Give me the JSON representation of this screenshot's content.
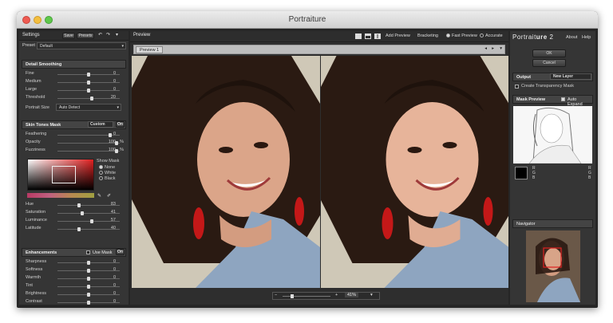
{
  "window": {
    "title": "Portraiture"
  },
  "settings": {
    "title": "Settings",
    "save": "Save",
    "presets": "Presets",
    "preset_label": "Preset",
    "preset_value": "Default"
  },
  "detail": {
    "title": "Detail Smoothing",
    "rows": [
      {
        "label": "Fine",
        "value": "0",
        "frac": 0.5
      },
      {
        "label": "Medium",
        "value": "0",
        "frac": 0.5
      },
      {
        "label": "Large",
        "value": "0",
        "frac": 0.5
      },
      {
        "label": "Threshold",
        "value": "20",
        "frac": 0.55
      }
    ],
    "portrait_size_label": "Portrait Size",
    "portrait_size_value": "Auto Detect"
  },
  "mask": {
    "title": "Skin Tones Mask",
    "mode": "Custom",
    "toggle": "On",
    "rows": [
      {
        "label": "Feathering",
        "value": "0",
        "unit": "",
        "frac": 0.85
      },
      {
        "label": "Opacity",
        "value": "100",
        "unit": "%",
        "frac": 0.95
      },
      {
        "label": "Fuzziness",
        "value": "100",
        "unit": "%",
        "frac": 0.95
      }
    ],
    "show_mask_label": "Show Mask",
    "show_mask_options": [
      "None",
      "White",
      "Black"
    ],
    "hsl": [
      {
        "label": "Hue",
        "value": "83",
        "frac": 0.35
      },
      {
        "label": "Saturation",
        "value": "41",
        "frac": 0.4
      },
      {
        "label": "Luminance",
        "value": "57",
        "frac": 0.55
      },
      {
        "label": "Latitude",
        "value": "40",
        "frac": 0.35
      }
    ]
  },
  "enh": {
    "title": "Enhancements",
    "use_mask": "Use Mask",
    "toggle": "On",
    "rows": [
      {
        "label": "Sharpness",
        "value": "0",
        "frac": 0.5
      },
      {
        "label": "Softness",
        "value": "0",
        "frac": 0.5
      },
      {
        "label": "Warmth",
        "value": "0",
        "frac": 0.5
      },
      {
        "label": "Tint",
        "value": "0",
        "frac": 0.5
      },
      {
        "label": "Brightness",
        "value": "0",
        "frac": 0.5
      },
      {
        "label": "Contrast",
        "value": "0",
        "frac": 0.5
      }
    ]
  },
  "preview": {
    "title": "Preview",
    "tab": "Preview 1",
    "add_preview": "Add Preview",
    "bracketing": "Bracketing",
    "fast_preview": "Fast Preview",
    "accurate": "Accurate",
    "zoom": "41%"
  },
  "right": {
    "logo_a": "Portrait",
    "logo_b": "ure",
    "logo_num": "2",
    "about": "About",
    "help": "Help",
    "ok": "OK",
    "cancel": "Cancel",
    "output_title": "Output",
    "output_value": "New Layer",
    "create_mask": "Create Transparency Mask",
    "mask_preview": "Mask Preview",
    "auto_expand": "Auto Expand",
    "swatch_left": [
      "R",
      "G",
      "B"
    ],
    "swatch_right": [
      "R",
      "G",
      "B"
    ],
    "navigator": "Navigator"
  },
  "colors": {
    "accent": "#cc2222",
    "panel": "#353535",
    "header": "#2d2d2d"
  }
}
